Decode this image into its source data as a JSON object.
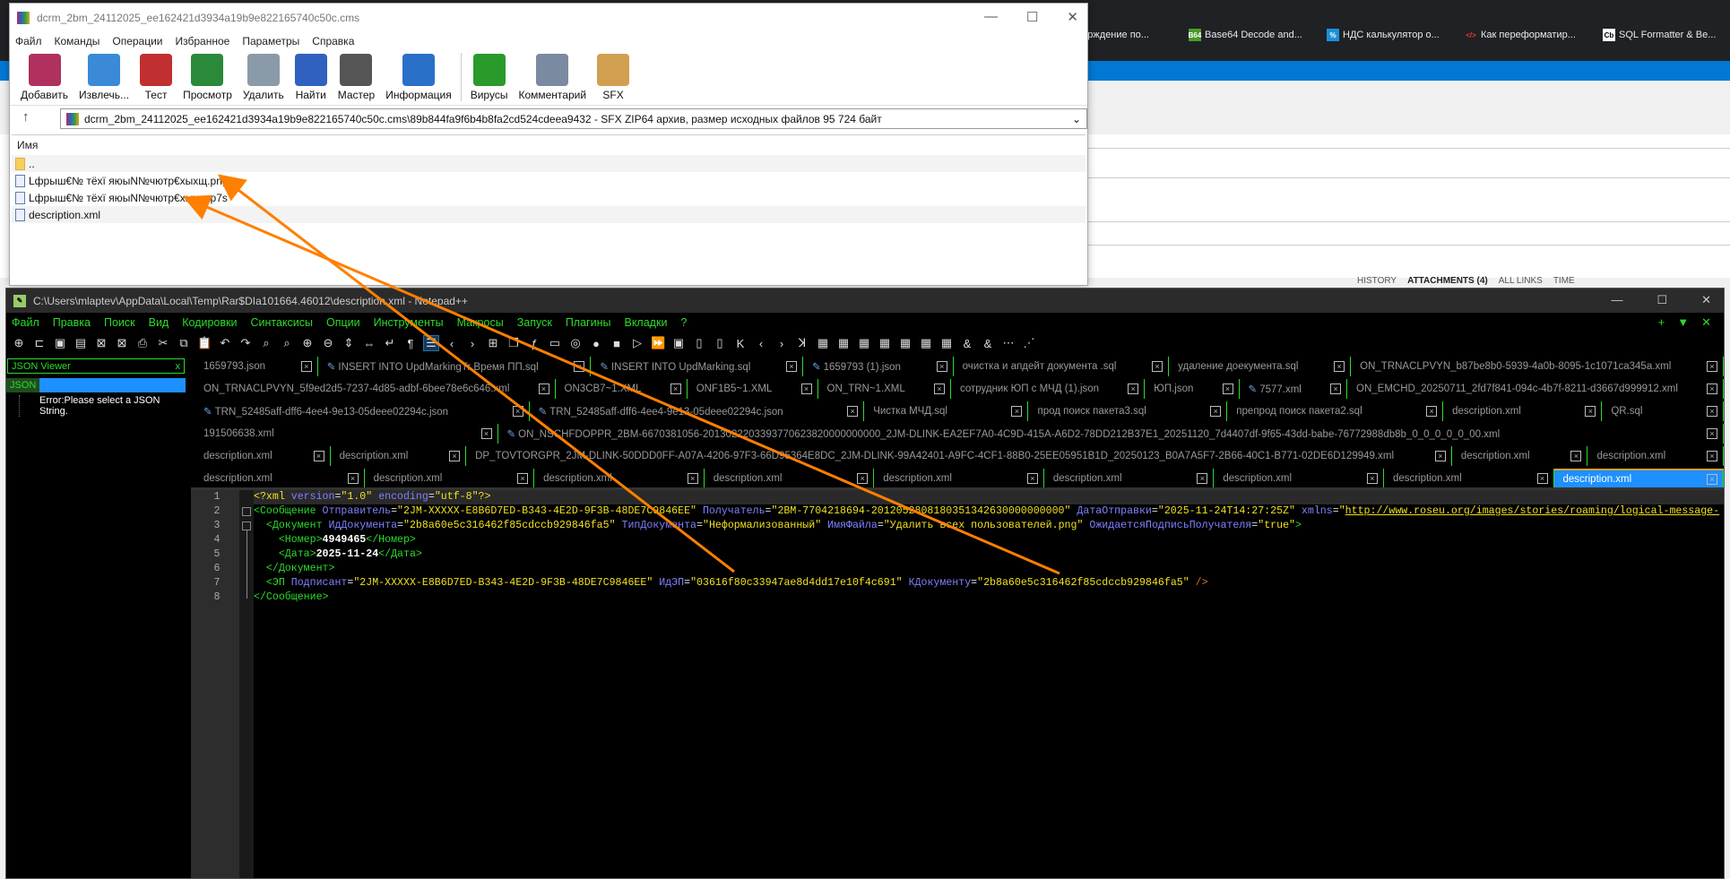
{
  "browser": {
    "bookmarks": [
      {
        "icon": "bookmark-icon",
        "label": "дтверждение по..."
      },
      {
        "icon": "b64-icon",
        "label": "Base64 Decode and..."
      },
      {
        "icon": "percent-icon",
        "label": "НДС калькулятор о..."
      },
      {
        "icon": "code-icon",
        "label": "Как переформатир..."
      },
      {
        "icon": "cb-icon",
        "label": "SQL Formatter & Be..."
      }
    ],
    "links_tabs": [
      "HISTORY",
      "ATTACHMENTS (4)",
      "ALL LINKS",
      "TIME"
    ],
    "accent": "#0078d4"
  },
  "winrar": {
    "title": "dcrm_2bm_24112025_ee162421d3934a19b9e822165740c50c.cms",
    "menu": [
      "Файл",
      "Команды",
      "Операции",
      "Избранное",
      "Параметры",
      "Справка"
    ],
    "toolbar": [
      {
        "icon": "archive-add-icon",
        "label": "Добавить",
        "color": "#b03060"
      },
      {
        "icon": "folder-extract-icon",
        "label": "Извлечь...",
        "color": "#3a8ad8"
      },
      {
        "icon": "test-clipboard-icon",
        "label": "Тест",
        "color": "#c03030"
      },
      {
        "icon": "book-view-icon",
        "label": "Просмотр",
        "color": "#2a8a3a"
      },
      {
        "icon": "trash-icon",
        "label": "Удалить",
        "color": "#8a9aa8"
      },
      {
        "icon": "magnifier-icon",
        "label": "Найти",
        "color": "#3060c0"
      },
      {
        "icon": "wizard-icon",
        "label": "Мастер",
        "color": "#555"
      },
      {
        "icon": "info-icon",
        "label": "Информация",
        "color": "#2a70c8"
      },
      {
        "icon": "virus-icon",
        "label": "Вирусы",
        "color": "#2a9a2a"
      },
      {
        "icon": "comment-icon",
        "label": "Комментарий",
        "color": "#7a8aa0"
      },
      {
        "icon": "sfx-box-icon",
        "label": "SFX",
        "color": "#d0a050"
      }
    ],
    "address": "dcrm_2bm_24112025_ee162421d3934a19b9e822165740c50c.cms\\89b844fa9f6b4b8fa2cd524cdeea9432 - SFX ZIP64 архив, размер исходных файлов 95 724 байт",
    "column_name": "Имя",
    "files": [
      {
        "icon": "folder-up-icon",
        "name": ".."
      },
      {
        "icon": "image-file-icon",
        "name": "Lфрыш€№ тёхї яюыN№чютр€хыхщ.png"
      },
      {
        "icon": "p7s-file-icon",
        "name": "Lфрыш€№ тёхї яюыN№чютр€хыхщ.p7s"
      },
      {
        "icon": "xml-file-icon",
        "name": "description.xml"
      }
    ]
  },
  "npp": {
    "title": "C:\\Users\\mlaptev\\AppData\\Local\\Temp\\Rar$DIa101664.46012\\description.xml - Notepad++",
    "menu": [
      "Файл",
      "Правка",
      "Поиск",
      "Вид",
      "Кодировки",
      "Синтаксисы",
      "Опции",
      "Инструменты",
      "Макросы",
      "Запуск",
      "Плагины",
      "Вкладки",
      "?"
    ],
    "right_controls": [
      "+",
      "▼",
      "✕"
    ],
    "toolbar_icons": [
      "new-file-icon",
      "open-icon",
      "save-icon",
      "save-all-icon",
      "close-icon",
      "close-all-icon",
      "print-icon",
      "cut-icon",
      "copy-icon",
      "paste-icon",
      "undo-icon",
      "redo-icon",
      "find-icon",
      "replace-icon",
      "zoom-in-icon",
      "zoom-out-icon",
      "sync-v-icon",
      "sync-h-icon",
      "wrap-icon",
      "show-all-chars-icon",
      "indent-guide-icon",
      "xml-tag-icon",
      "map-icon",
      "doc-list-icon",
      "function-list-icon",
      "folder-workspace-icon",
      "monitor-icon",
      "record-macro-icon",
      "stop-macro-icon",
      "play-macro-icon",
      "run-macro-multiple-icon",
      "save-macro-icon",
      "compare-icon",
      "compare-clear-icon",
      "first-icon",
      "prev-icon",
      "next-icon",
      "last-icon",
      "plugin-1-icon",
      "plugin-2-icon",
      "plugin-3-icon",
      "plugin-4-icon",
      "plugin-5-icon",
      "plugin-6-icon",
      "plugin-7-icon",
      "plugin-8-icon",
      "plugin-9-icon",
      "comment-icon",
      "uncomment-icon",
      "settings-icon"
    ],
    "json_viewer": {
      "title": "JSON Viewer",
      "close": "x",
      "root": "JSON",
      "error": "Error:Please select a JSON String."
    },
    "tab_rows": [
      [
        {
          "n": "1659793.json"
        },
        {
          "n": "INSERT INTO UpdMarkingTr Время ПП.sql",
          "m": 1
        },
        {
          "n": "INSERT INTO UpdMarking.sql",
          "m": 1
        },
        {
          "n": "1659793 (1).json",
          "m": 1
        },
        {
          "n": "очистка и апдейт документа .sql"
        },
        {
          "n": "удаление доекумента.sql"
        },
        {
          "n": "ON_TRNACLPVYN_b87be8b0-5939-4a0b-8095-1c1071ca345a.xml"
        }
      ],
      [
        {
          "n": "ON_TRNACLPVYN_5f9ed2d5-7237-4d85-adbf-6bee78e6c646.xml"
        },
        {
          "n": "ON3CB7~1.XML"
        },
        {
          "n": "ONF1B5~1.XML"
        },
        {
          "n": "ON_TRN~1.XML"
        },
        {
          "n": "сотрудник ЮП с МЧД (1).json"
        },
        {
          "n": "ЮП.json"
        },
        {
          "n": "7577.xml",
          "m": 1
        },
        {
          "n": "ON_EMCHD_20250711_2fd7f841-094c-4b7f-8211-d3667d999912.xml"
        }
      ],
      [
        {
          "n": "TRN_52485aff-dff6-4ee4-9e13-05deee02294c.json",
          "m": 1
        },
        {
          "n": "TRN_52485aff-dff6-4ee4-9e13-05deee02294c.json",
          "m": 1
        },
        {
          "n": "Чистка МЧД.sql"
        },
        {
          "n": "прод поиск пакета3.sql"
        },
        {
          "n": "препрод поиск пакета2.sql"
        },
        {
          "n": "description.xml"
        },
        {
          "n": "QR.sql"
        }
      ],
      [
        {
          "n": "191506638.xml"
        },
        {
          "n": "ON_NSCHFDOPPR_2BM-6670381056-2013022203393770623820000000000_2JM-DLINK-EA2EF7A0-4C9D-415A-A6D2-78DD212B37E1_20251120_7d4407df-9f65-43dd-babe-76772988db8b_0_0_0_0_0_00.xml",
          "m": 1
        }
      ],
      [
        {
          "n": "description.xml"
        },
        {
          "n": "description.xml"
        },
        {
          "n": "DP_TOVTORGPR_2JM-DLINK-50DDD0FF-A07A-4206-97F3-66D95364E8DC_2JM-DLINK-99A42401-A9FC-4CF1-88B0-25EE05951B1D_20250123_B0A7A5F7-2B66-40C1-B771-02DE6D129949.xml"
        },
        {
          "n": "description.xml"
        },
        {
          "n": "description.xml"
        }
      ],
      [
        {
          "n": "description.xml"
        },
        {
          "n": "description.xml"
        },
        {
          "n": "description.xml"
        },
        {
          "n": "description.xml"
        },
        {
          "n": "description.xml"
        },
        {
          "n": "description.xml"
        },
        {
          "n": "description.xml"
        },
        {
          "n": "description.xml"
        },
        {
          "n": "description.xml",
          "active": 1
        }
      ]
    ],
    "line_numbers": [
      "1",
      "2",
      "3",
      "4",
      "5",
      "6",
      "7",
      "8"
    ],
    "code_lines": [
      [
        [
          "pi",
          "<?xml "
        ],
        [
          "attr",
          "version"
        ],
        [
          "eq",
          "="
        ],
        [
          "val",
          "\"1.0\""
        ],
        [
          "pi",
          " "
        ],
        [
          "attr",
          "encoding"
        ],
        [
          "eq",
          "="
        ],
        [
          "val",
          "\"utf-8\""
        ],
        [
          "pi",
          "?>"
        ]
      ],
      [
        [
          "tag",
          "<Сообщение "
        ],
        [
          "attr",
          "Отправитель"
        ],
        [
          "eq",
          "="
        ],
        [
          "val",
          "\"2JM-XXXXX-E8B6D7ED-B343-4E2D-9F3B-48DE7C9846EE\" "
        ],
        [
          "attr",
          "Получатель"
        ],
        [
          "eq",
          "="
        ],
        [
          "val",
          "\"2BM-7704218694-2012052808180351342630000000000\" "
        ],
        [
          "attr",
          "ДатаОтправки"
        ],
        [
          "eq",
          "="
        ],
        [
          "val",
          "\"2025-11-24T14:27:25Z\" "
        ],
        [
          "attr",
          "xmlns"
        ],
        [
          "eq",
          "="
        ],
        [
          "val",
          "\""
        ],
        [
          "url",
          "http://www.roseu.org/images/stories/roaming/logical-message-"
        ]
      ],
      [
        [
          "tag",
          "  <Документ "
        ],
        [
          "attr",
          "ИдДокумента"
        ],
        [
          "eq",
          "="
        ],
        [
          "val",
          "\"2b8a60e5c316462f85cdccb929846fa5\" "
        ],
        [
          "attr",
          "ТипДокумента"
        ],
        [
          "eq",
          "="
        ],
        [
          "val",
          "\"Неформализованный\" "
        ],
        [
          "attr",
          "ИмяФайла"
        ],
        [
          "eq",
          "="
        ],
        [
          "val",
          "\"Удалить всех пользователей.png\" "
        ],
        [
          "attr",
          "ОжидаетсяПодписьПолучателя"
        ],
        [
          "eq",
          "="
        ],
        [
          "val",
          "\"true\""
        ],
        [
          "tag",
          ">"
        ]
      ],
      [
        [
          "tag",
          "    <Номер>"
        ],
        [
          "txt",
          "4949465"
        ],
        [
          "tag",
          "</Номер>"
        ]
      ],
      [
        [
          "tag",
          "    <Дата>"
        ],
        [
          "txt",
          "2025-11-24"
        ],
        [
          "tag",
          "</Дата>"
        ]
      ],
      [
        [
          "tag",
          "  </Документ>"
        ]
      ],
      [
        [
          "tag",
          "  <ЭП "
        ],
        [
          "attr",
          "Подписант"
        ],
        [
          "eq",
          "="
        ],
        [
          "val",
          "\"2JM-XXXXX-E8B6D7ED-B343-4E2D-9F3B-48DE7C9846EE\" "
        ],
        [
          "attr",
          "ИдЭП"
        ],
        [
          "eq",
          "="
        ],
        [
          "val",
          "\"03616f80c33947ae8d4dd17e10f4c691\" "
        ],
        [
          "attr",
          "КДокументу"
        ],
        [
          "eq",
          "="
        ],
        [
          "val",
          "\"2b8a60e5c316462f85cdccb929846fa5\" "
        ],
        [
          "end",
          "/>"
        ]
      ],
      [
        [
          "tag",
          "</Сообщение>"
        ]
      ]
    ],
    "annotation_color": "#ff7f00"
  }
}
